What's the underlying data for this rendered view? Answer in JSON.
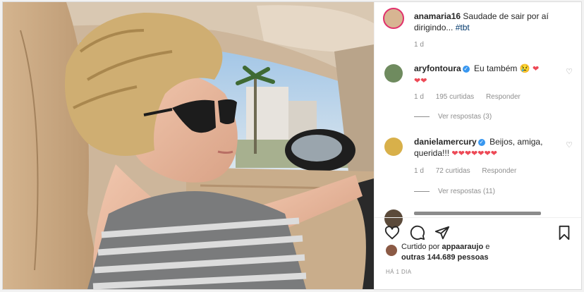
{
  "post": {
    "author": "anamaria16",
    "caption_text": "Saudade de sair por aí dirigindo...",
    "caption_hashtag": "#tbt",
    "caption_time": "1 d",
    "likes_prefix": "Curtido por",
    "likes_user": "appaaraujo",
    "likes_conj": "e",
    "likes_others": "outras 144.689 pessoas",
    "time_ago": "HÁ 1 DIA"
  },
  "comments": [
    {
      "user": "aryfontoura",
      "text": "Eu também",
      "emoji": "😢",
      "hearts_inline": "❤",
      "hearts_line2": "❤❤",
      "time": "1 d",
      "likes": "195 curtidas",
      "reply": "Responder",
      "view_replies": "Ver respostas (3)"
    },
    {
      "user": "danielamercury",
      "text": "Beijos, amiga,",
      "text_line2": "querida!!!",
      "hearts": "❤❤❤❤❤❤❤",
      "time": "1 d",
      "likes": "72 curtidas",
      "reply": "Responder",
      "view_replies": "Ver respostas (11)"
    }
  ],
  "icons": {
    "like": "heart-outline-icon",
    "comment": "comment-icon",
    "share": "send-icon",
    "save": "bookmark-icon",
    "small_like": "♡"
  },
  "colors": {
    "verified": "#3897f0",
    "hashtag": "#00376b",
    "heart": "#ed4956",
    "muted": "#8e8e8e"
  }
}
